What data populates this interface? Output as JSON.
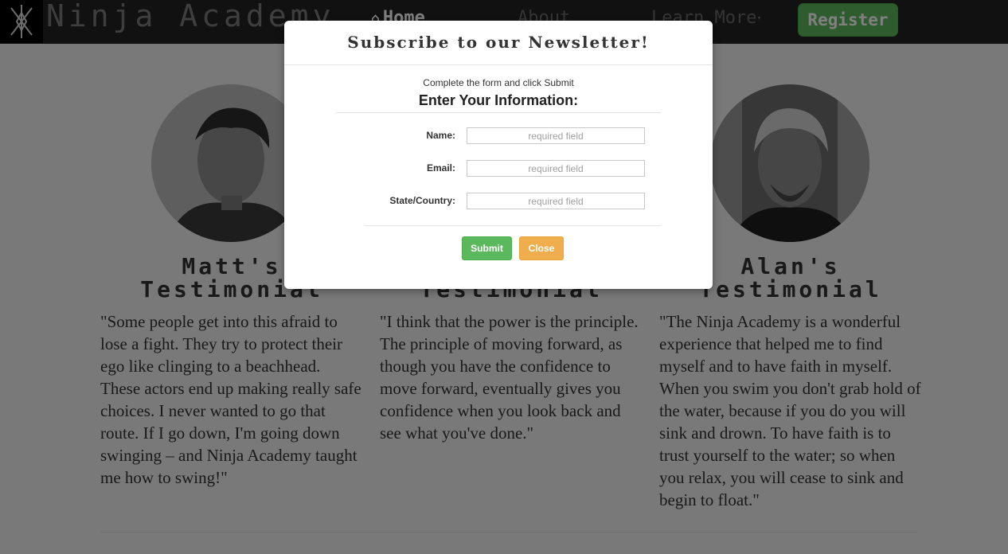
{
  "navbar": {
    "brand": "Ninja Academy",
    "links": [
      {
        "label": "Home",
        "icon": "home-icon",
        "active": true
      },
      {
        "label": "About"
      },
      {
        "label": "Learn More"
      }
    ],
    "register_label": "Register"
  },
  "testimonials": [
    {
      "title_line1": "Matt's",
      "title_line2": "Testimonial",
      "quote": "\"Some people get into this afraid to lose a fight. They try to protect their ego like clinging to a beachhead. These actors end up making really safe choices. I never wanted to go that route. If I go down, I'm going down swinging – and Ninja Academy taught me how to swing!\""
    },
    {
      "title_line1": "",
      "title_line2": "Testimonial",
      "quote": "\"I think that the power is the principle. The principle of moving forward, as though you have the confidence to move forward, eventually gives you confidence when you look back and see what you've done.\""
    },
    {
      "title_line1": "Alan's",
      "title_line2": "Testimonial",
      "quote": "\"The Ninja Academy is a wonderful experience that helped me to find myself and to have faith in myself. When you swim you don't grab hold of the water, because if you do you will sink and drown. To have faith is to trust yourself to the water; so when you relax, you will cease to sink and begin to float.\""
    }
  ],
  "modal": {
    "title": "Subscribe to our Newsletter!",
    "instructions": "Complete the form and click Submit",
    "heading": "Enter Your Information:",
    "fields": [
      {
        "label": "Name:",
        "placeholder": "required field",
        "value": ""
      },
      {
        "label": "Email:",
        "placeholder": "required field",
        "value": ""
      },
      {
        "label": "State/Country:",
        "placeholder": "required field",
        "value": ""
      }
    ],
    "submit_label": "Submit",
    "close_label": "Close"
  },
  "colors": {
    "navbar_bg": "#222222",
    "success": "#5cb85c",
    "warning": "#f0ad4e",
    "backdrop": "rgba(0,0,0,0.5)"
  }
}
